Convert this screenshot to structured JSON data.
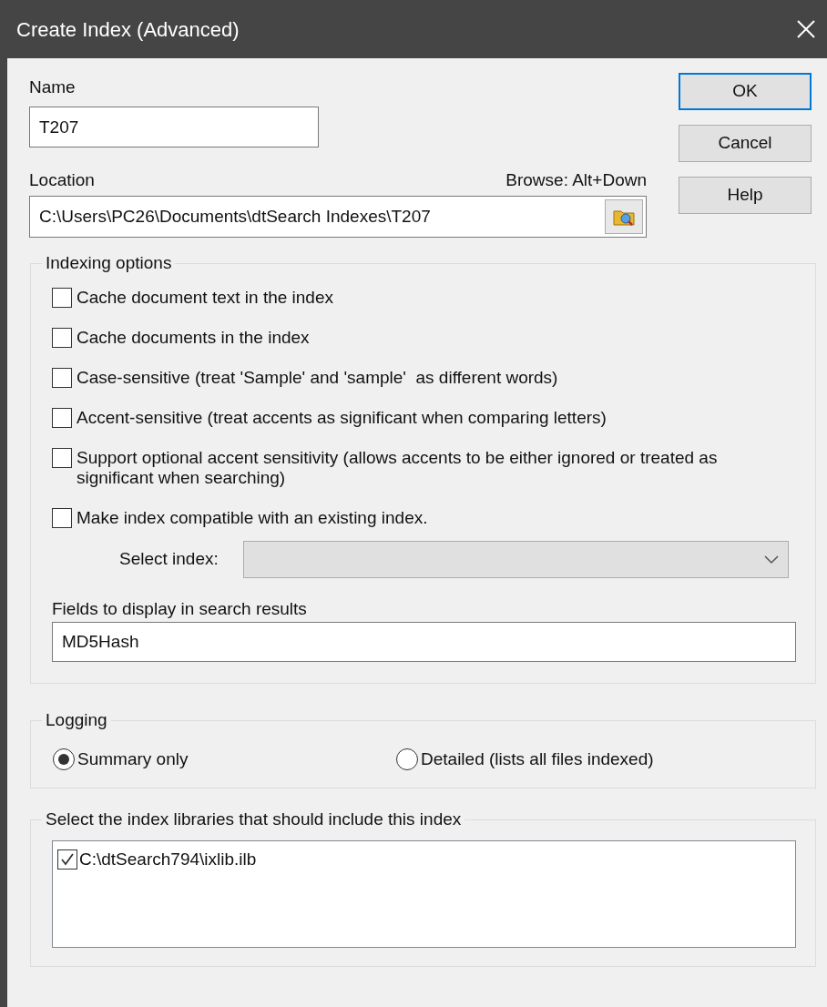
{
  "window": {
    "title": "Create Index (Advanced)"
  },
  "name_field": {
    "label": "Name",
    "value": "T207"
  },
  "location_field": {
    "label": "Location",
    "hint": "Browse: Alt+Down",
    "value": "C:\\Users\\PC26\\Documents\\dtSearch Indexes\\T207"
  },
  "buttons": [
    {
      "label": "OK",
      "default": true
    },
    {
      "label": "Cancel",
      "default": false
    },
    {
      "label": "Help",
      "default": false
    }
  ],
  "indexing_options": {
    "title": "Indexing options",
    "options": [
      {
        "label": "Cache document text in the index",
        "checked": false
      },
      {
        "label": "Cache documents in the index",
        "checked": false
      },
      {
        "label": "Case-sensitive (treat 'Sample' and 'sample'  as different words)",
        "checked": false
      },
      {
        "label": "Accent-sensitive (treat accents as significant when comparing letters)",
        "checked": false
      },
      {
        "label": "Support optional accent sensitivity (allows accents to be either ignored or treated as significant when searching)",
        "checked": false
      },
      {
        "label": "Make index compatible with an existing index.",
        "checked": false
      }
    ],
    "select_index": {
      "label": "Select index:",
      "disabled": true
    },
    "fields": {
      "label": "Fields to display in search results",
      "value": "MD5Hash"
    }
  },
  "logging": {
    "title": "Logging",
    "options": [
      {
        "label": "Summary only",
        "selected": true
      },
      {
        "label": "Detailed (lists all files indexed)",
        "selected": false
      }
    ]
  },
  "libraries": {
    "title": "Select the index libraries that should include this index",
    "items": [
      {
        "label": "C:\\dtSearch794\\ixlib.ilb",
        "checked": true
      }
    ]
  }
}
